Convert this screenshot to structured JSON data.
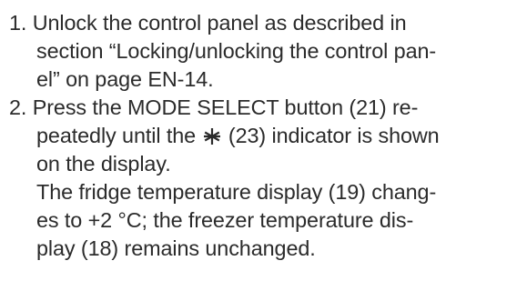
{
  "instructions": {
    "step1": {
      "number": "1.",
      "line1": "Unlock the control panel as described in",
      "line2": "section “Locking/unlocking the control pan-",
      "line3": "el” on page EN-14."
    },
    "step2": {
      "number": "2.",
      "line1": "Press the MODE SELECT button (21) re-",
      "line2_before_icon": "peatedly until the",
      "icon": "snowflake-icon",
      "line2_after_icon": "(23) indicator is shown",
      "line3": "on the display.",
      "result_line1": "The fridge temperature display (19) chang-",
      "result_line2": "es to +2 °C; the freezer temperature dis-",
      "result_line3": "play (18) remains unchanged."
    }
  }
}
